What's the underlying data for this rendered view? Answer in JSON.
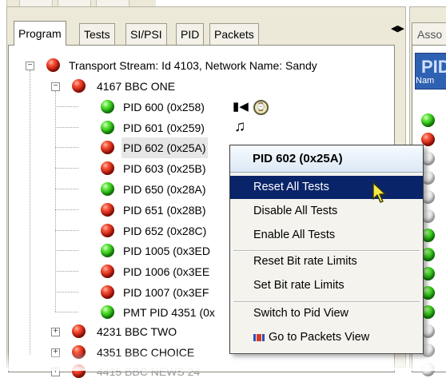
{
  "tabs": [
    {
      "label": "Program",
      "active": true
    },
    {
      "label": "Tests",
      "active": false
    },
    {
      "label": "SI/PSI",
      "active": false
    },
    {
      "label": "PID",
      "active": false
    },
    {
      "label": "Packets",
      "active": false
    }
  ],
  "right_panel": {
    "tab_label": "Asso",
    "header_title": "PID",
    "column_label": "Nam",
    "status_colors": [
      "green",
      "red",
      "white",
      "white",
      "white",
      "white",
      "green",
      "green",
      "green",
      "green",
      "green",
      "white",
      "white",
      "white"
    ]
  },
  "tree": {
    "root": {
      "label": "Transport Stream: Id 4103, Network Name: Sandy",
      "status": "red",
      "expanded": true
    },
    "programs": [
      {
        "label": "4167 BBC ONE",
        "status": "red",
        "expanded": true,
        "pids": [
          {
            "label": "PID 600 (0x258)",
            "status": "green",
            "icons": [
              "video-camera-icon",
              "clock-icon"
            ]
          },
          {
            "label": "PID 601 (0x259)",
            "status": "green",
            "icons": [
              "music-note-icon"
            ]
          },
          {
            "label": "PID 602 (0x25A)",
            "status": "red",
            "selected": true
          },
          {
            "label": "PID 603 (0x25B)",
            "status": "red"
          },
          {
            "label": "PID 650 (0x28A)",
            "status": "green"
          },
          {
            "label": "PID 651 (0x28B)",
            "status": "red"
          },
          {
            "label": "PID 652 (0x28C)",
            "status": "red"
          },
          {
            "label": "PID 1005 (0x3ED",
            "status": "green"
          },
          {
            "label": "PID 1006 (0x3EE",
            "status": "red"
          },
          {
            "label": "PID 1007 (0x3EF",
            "status": "red"
          },
          {
            "label": "PMT PID 4351 (0x",
            "status": "green"
          }
        ]
      },
      {
        "label": "4231 BBC TWO",
        "status": "red",
        "expanded": false
      },
      {
        "label": "4351 BBC CHOICE",
        "status": "red",
        "expanded": false
      },
      {
        "label": "4415 BBC NEWS 24",
        "status": "red",
        "expanded": false
      }
    ]
  },
  "context_menu": {
    "title": "PID 602 (0x25A)",
    "groups": [
      [
        {
          "label": "Reset All Tests",
          "hover": true
        },
        {
          "label": "Disable All Tests"
        },
        {
          "label": "Enable All Tests"
        }
      ],
      [
        {
          "label": "Reset Bit rate Limits"
        },
        {
          "label": "Set Bit rate Limits"
        }
      ],
      [
        {
          "label": "Switch to Pid View"
        },
        {
          "label": "Go to Packets View",
          "icon": "packets-icon"
        }
      ]
    ]
  },
  "colors": {
    "status_red": "#c81a0f",
    "status_green": "#1fae0d",
    "menu_highlight": "#0a246a",
    "panel_header_blue": "#2f61b3"
  }
}
